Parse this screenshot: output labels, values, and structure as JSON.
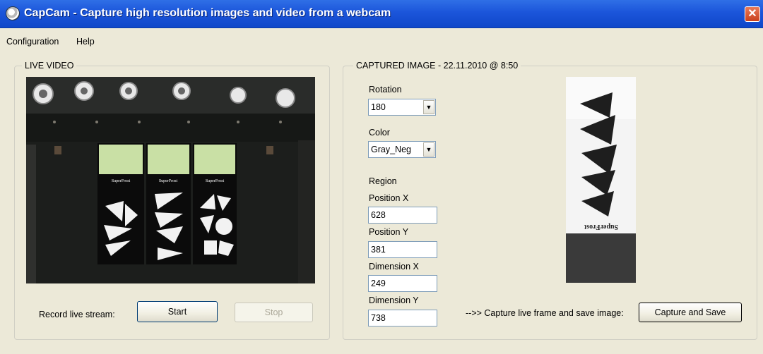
{
  "window": {
    "title": "CapCam - Capture high resolution images and video from a webcam",
    "close_glyph": "✕"
  },
  "menu": [
    {
      "label": "Configuration"
    },
    {
      "label": "Help"
    }
  ],
  "live_video": {
    "group_label": "LIVE VIDEO",
    "slide_labels": [
      "SuperFrost",
      "SuperFrost",
      "SuperFrost"
    ],
    "record_label": "Record live stream:",
    "start_label": "Start",
    "stop_label": "Stop"
  },
  "captured": {
    "group_label": "CAPTURED IMAGE - 22.11.2010 @ 8:50",
    "rotation_label": "Rotation",
    "rotation_value": "180",
    "color_label": "Color",
    "color_value": "Gray_Neg",
    "region_label": "Region",
    "pos_x_label": "Position X",
    "pos_x_value": "628",
    "pos_y_label": "Position Y",
    "pos_y_value": "381",
    "dim_x_label": "Dimension X",
    "dim_x_value": "249",
    "dim_y_label": "Dimension Y",
    "dim_y_value": "738",
    "capture_hint": "-->> Capture live frame and save image:",
    "capture_button": "Capture and Save",
    "slide_label": "SuperFrost"
  },
  "icons": {
    "app": "webcam-icon",
    "close": "close-icon",
    "dropdown": "chevron-down-icon"
  },
  "colors": {
    "titlebar": "#1b55da",
    "window_bg": "#ece9d8",
    "input_border": "#7f9db9",
    "button_border": "#003c74"
  }
}
